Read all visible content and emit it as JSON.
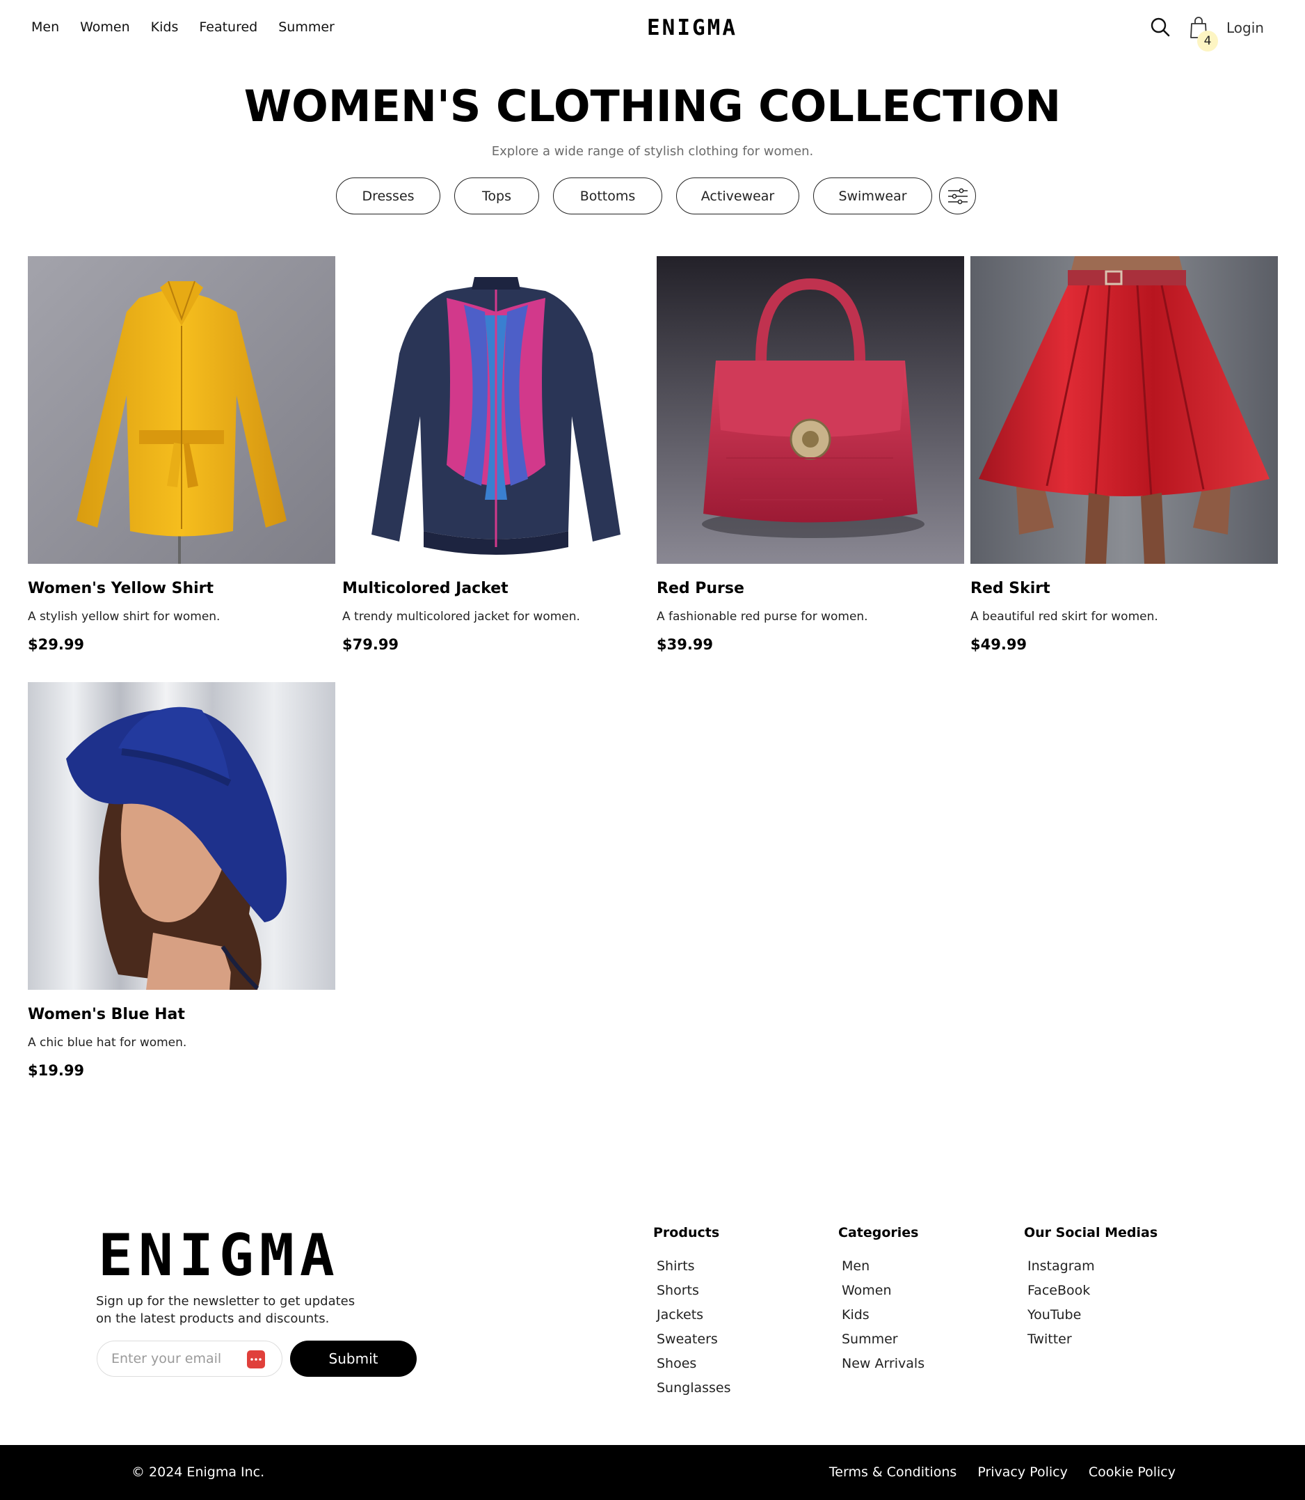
{
  "header": {
    "nav": [
      "Men",
      "Women",
      "Kids",
      "Featured",
      "Summer"
    ],
    "logo": "ENIGMA",
    "cart_count": "4",
    "login_label": "Login"
  },
  "hero": {
    "title": "WOMEN'S CLOTHING COLLECTION",
    "subtitle": "Explore a wide range of stylish clothing for women.",
    "filters": [
      "Dresses",
      "Tops",
      "Bottoms",
      "Activewear",
      "Swimwear"
    ]
  },
  "products": [
    {
      "name": "Women's Yellow Shirt",
      "description": "A stylish yellow shirt for women.",
      "price": "$29.99"
    },
    {
      "name": "Multicolored Jacket",
      "description": "A trendy multicolored jacket for women.",
      "price": "$79.99"
    },
    {
      "name": "Red Purse",
      "description": "A fashionable red purse for women.",
      "price": "$39.99"
    },
    {
      "name": "Red Skirt",
      "description": "A beautiful red skirt for women.",
      "price": "$49.99"
    },
    {
      "name": "Women's Blue Hat",
      "description": "A chic blue hat for women.",
      "price": "$19.99"
    }
  ],
  "footer": {
    "logo": "ENIGMA",
    "newsletter_text": "Sign up for the newsletter to get updates on the latest products and discounts.",
    "email_placeholder": "Enter your email",
    "submit_label": "Submit",
    "columns": [
      {
        "title": "Products",
        "items": [
          "Shirts",
          "Shorts",
          "Jackets",
          "Sweaters",
          "Shoes",
          "Sunglasses"
        ]
      },
      {
        "title": "Categories",
        "items": [
          "Men",
          "Women",
          "Kids",
          "Summer",
          "New Arrivals"
        ]
      },
      {
        "title": "Our Social Medias",
        "items": [
          "Instagram",
          "FaceBook",
          "YouTube",
          "Twitter"
        ]
      }
    ],
    "copyright": "© 2024 Enigma Inc.",
    "legal": [
      "Terms & Conditions",
      "Privacy Policy",
      "Cookie Policy"
    ]
  },
  "colors": {
    "accent": "#000000",
    "cart_badge": "#fdf5c3",
    "email_icon": "#e0403b"
  },
  "icons": [
    "search-icon",
    "shopping-bag-icon",
    "filter-sliders-icon",
    "password-dots-icon"
  ]
}
